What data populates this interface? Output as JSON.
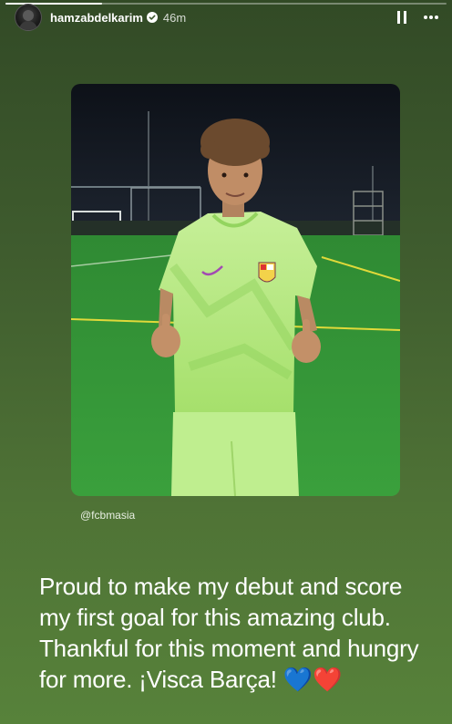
{
  "story": {
    "progress_fraction": 0.22,
    "username": "hamzabdelkarim",
    "time_ago": "46m",
    "photo_tag": "@fcbmasia",
    "caption_lines": [
      "Proud to make my debut and score",
      "my first goal for this amazing club.",
      "Thankful for this moment and hungry",
      "for more. ¡Visca Barça! 💙❤️"
    ]
  },
  "icons": {
    "verified": "verified-badge-icon",
    "pause": "pause-icon",
    "more": "more-options-icon"
  },
  "colors": {
    "background_top": "#324a26",
    "background_bottom": "#57823a",
    "text": "#ffffff"
  }
}
